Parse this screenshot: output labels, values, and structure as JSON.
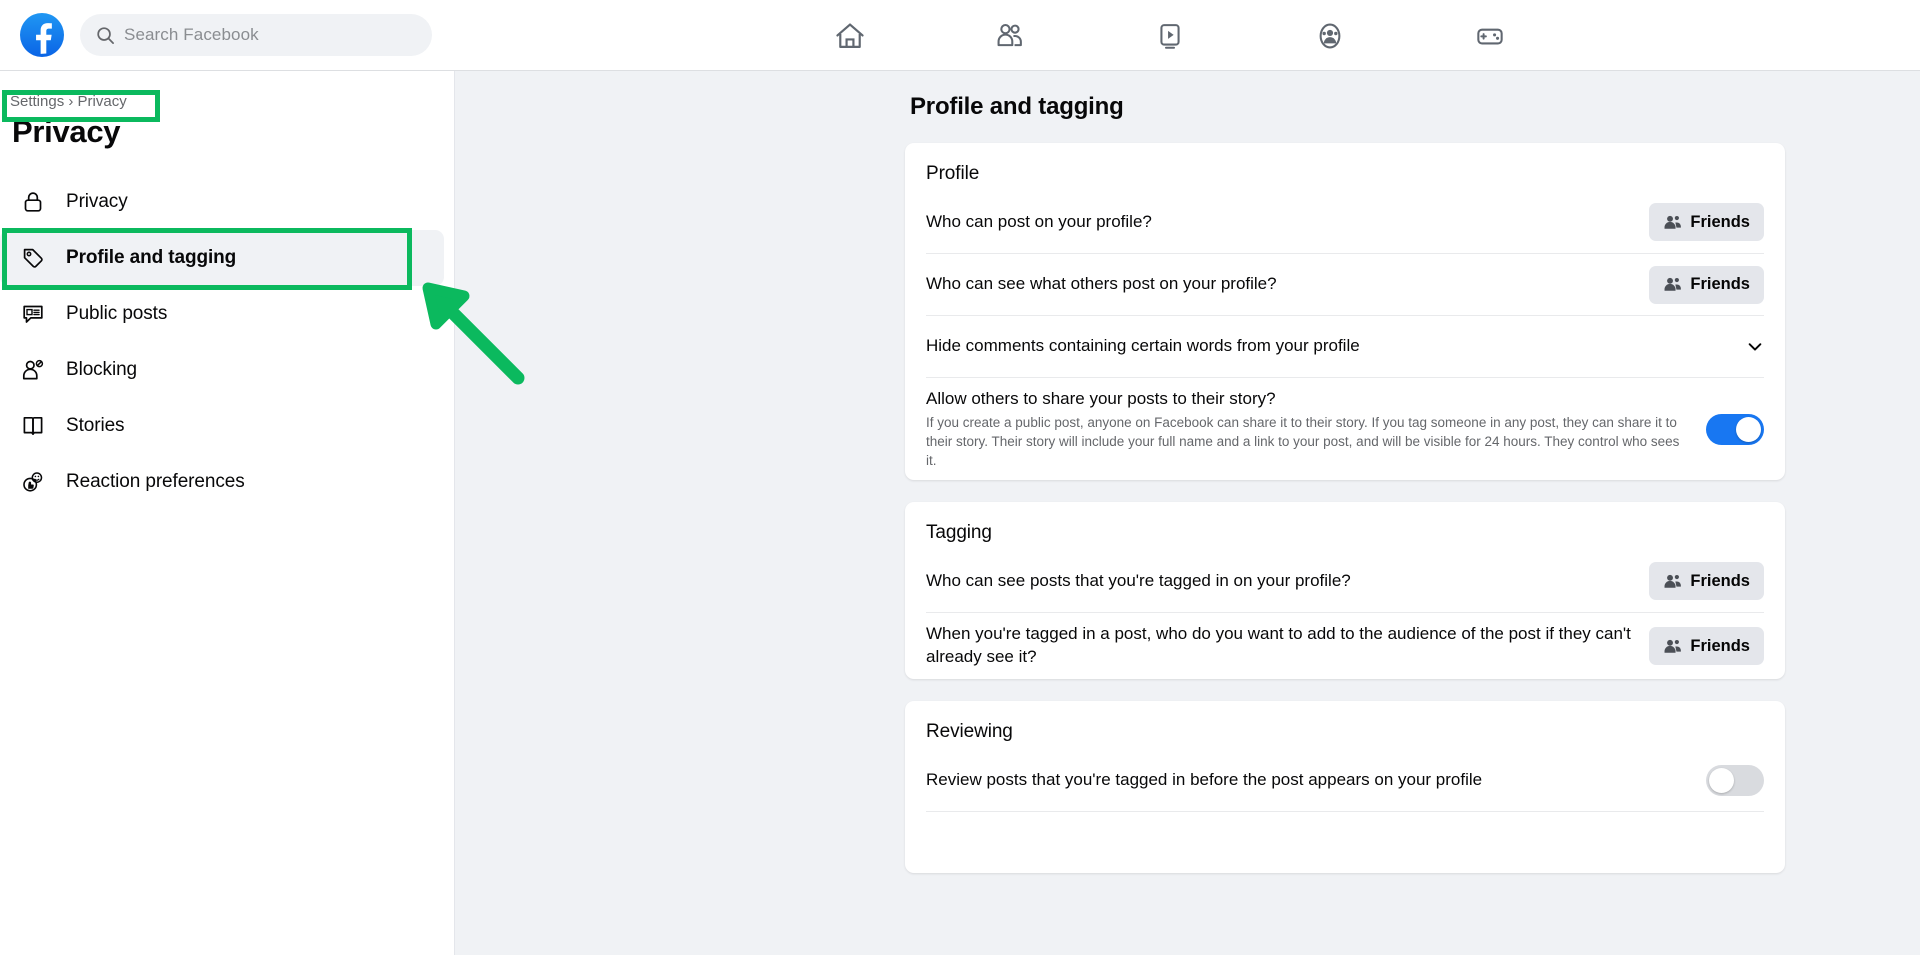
{
  "topbar": {
    "logo_icon": "facebook-logo-icon",
    "search": {
      "icon": "search-icon",
      "placeholder": "Search Facebook",
      "value": ""
    },
    "nav_icons": [
      {
        "name": "home-icon",
        "label": "Home"
      },
      {
        "name": "friends-icon",
        "label": "Friends"
      },
      {
        "name": "video-icon",
        "label": "Video"
      },
      {
        "name": "groups-icon",
        "label": "Groups"
      },
      {
        "name": "gaming-icon",
        "label": "Gaming"
      }
    ]
  },
  "sidebar": {
    "breadcrumb": "Settings › Privacy",
    "title": "Privacy",
    "items": [
      {
        "label": "Privacy",
        "icon": "lock-icon",
        "active": false
      },
      {
        "label": "Profile and tagging",
        "icon": "tag-icon",
        "active": true
      },
      {
        "label": "Public posts",
        "icon": "public-post-icon",
        "active": false
      },
      {
        "label": "Blocking",
        "icon": "block-user-icon",
        "active": false
      },
      {
        "label": "Stories",
        "icon": "stories-book-icon",
        "active": false
      },
      {
        "label": "Reaction preferences",
        "icon": "reaction-icon",
        "active": false
      }
    ]
  },
  "main": {
    "title": "Profile and tagging",
    "sections": [
      {
        "heading": "Profile",
        "rows": [
          {
            "question": "Who can post on your profile?",
            "description": "",
            "control": "audience",
            "value": "Friends",
            "control_icon": "friends-audience-icon"
          },
          {
            "question": "Who can see what others post on your profile?",
            "description": "",
            "control": "audience",
            "value": "Friends",
            "control_icon": "friends-audience-icon"
          },
          {
            "question": "Hide comments containing certain words from your profile",
            "description": "",
            "control": "chevron",
            "value": "",
            "control_icon": "chevron-down-icon"
          },
          {
            "question": "Allow others to share your posts to their story?",
            "description": "If you create a public post, anyone on Facebook can share it to their story. If you tag someone in any post, they can share it to their story. Their story will include your full name and a link to your post, and will be visible for 24 hours. They control who sees it.",
            "control": "toggle",
            "value": "on",
            "control_icon": "toggle-switch-icon"
          }
        ]
      },
      {
        "heading": "Tagging",
        "rows": [
          {
            "question": "Who can see posts that you're tagged in on your profile?",
            "description": "",
            "control": "audience",
            "value": "Friends",
            "control_icon": "friends-audience-icon"
          },
          {
            "question": "When you're tagged in a post, who do you want to add to the audience of the post if they can't already see it?",
            "description": "",
            "control": "audience",
            "value": "Friends",
            "control_icon": "friends-audience-icon"
          }
        ]
      },
      {
        "heading": "Reviewing",
        "rows": [
          {
            "question": "Review posts that you're tagged in before the post appears on your profile",
            "description": "",
            "control": "toggle",
            "value": "off",
            "control_icon": "toggle-switch-icon"
          }
        ]
      }
    ]
  },
  "annotations": {
    "color": "#0bb95e",
    "items": [
      {
        "name": "highlight-breadcrumb",
        "shape": "box"
      },
      {
        "name": "highlight-profile-and-tagging",
        "shape": "box"
      },
      {
        "name": "pointer-arrow-to-profile-and-tagging",
        "shape": "arrow"
      }
    ]
  },
  "colors": {
    "brand_blue": "#1877f2",
    "annotation_green": "#0bb95e",
    "page_bg": "#f0f2f5",
    "card_bg": "#ffffff",
    "text_primary": "#080809",
    "text_secondary": "#65676b"
  }
}
